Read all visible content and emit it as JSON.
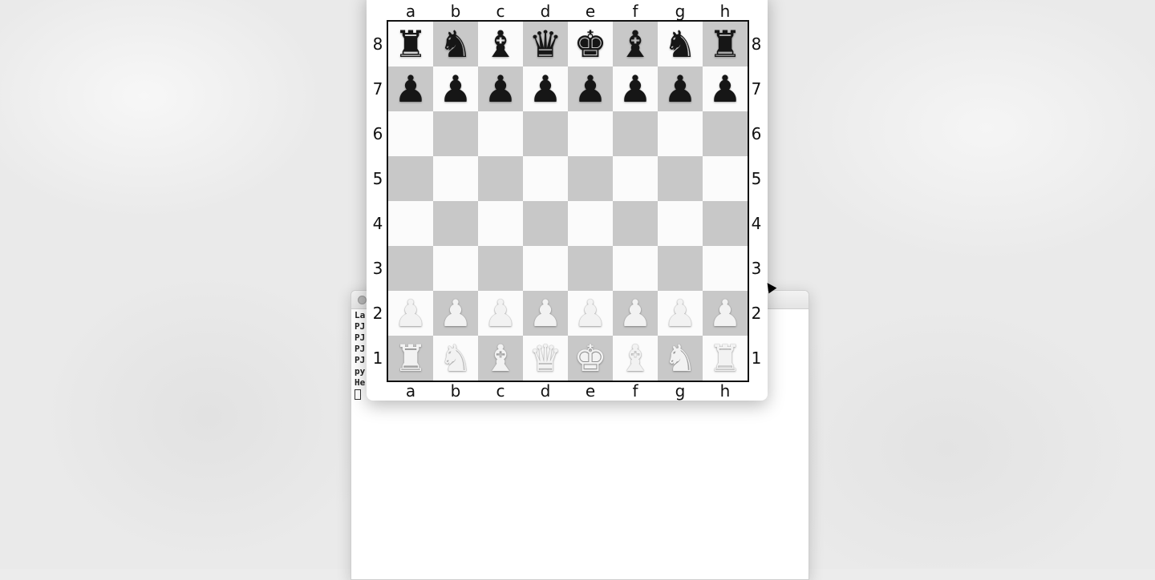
{
  "board": {
    "files": [
      "a",
      "b",
      "c",
      "d",
      "e",
      "f",
      "g",
      "h"
    ],
    "ranks": [
      "8",
      "7",
      "6",
      "5",
      "4",
      "3",
      "2",
      "1"
    ],
    "light_color": "#fbfbfb",
    "dark_color": "#c8c8c8",
    "pieces": {
      "a8": "rook-black",
      "b8": "knight-black",
      "c8": "bishop-black",
      "d8": "queen-black",
      "e8": "king-black",
      "f8": "bishop-black",
      "g8": "knight-black",
      "h8": "rook-black",
      "a7": "pawn-black",
      "b7": "pawn-black",
      "c7": "pawn-black",
      "d7": "pawn-black",
      "e7": "pawn-black",
      "f7": "pawn-black",
      "g7": "pawn-black",
      "h7": "pawn-black",
      "a2": "pawn-white",
      "b2": "pawn-white",
      "c2": "pawn-white",
      "d2": "pawn-white",
      "e2": "pawn-white",
      "f2": "pawn-white",
      "g2": "pawn-white",
      "h2": "pawn-white",
      "a1": "rook-white",
      "b1": "knight-white",
      "c1": "bishop-white",
      "d1": "queen-white",
      "e1": "king-white",
      "f1": "bishop-white",
      "g1": "knight-white",
      "h1": "rook-white"
    }
  },
  "terminal": {
    "lines": [
      "La",
      "PJ",
      "PJ",
      "PJ",
      "PJ",
      "py",
      "He"
    ]
  }
}
